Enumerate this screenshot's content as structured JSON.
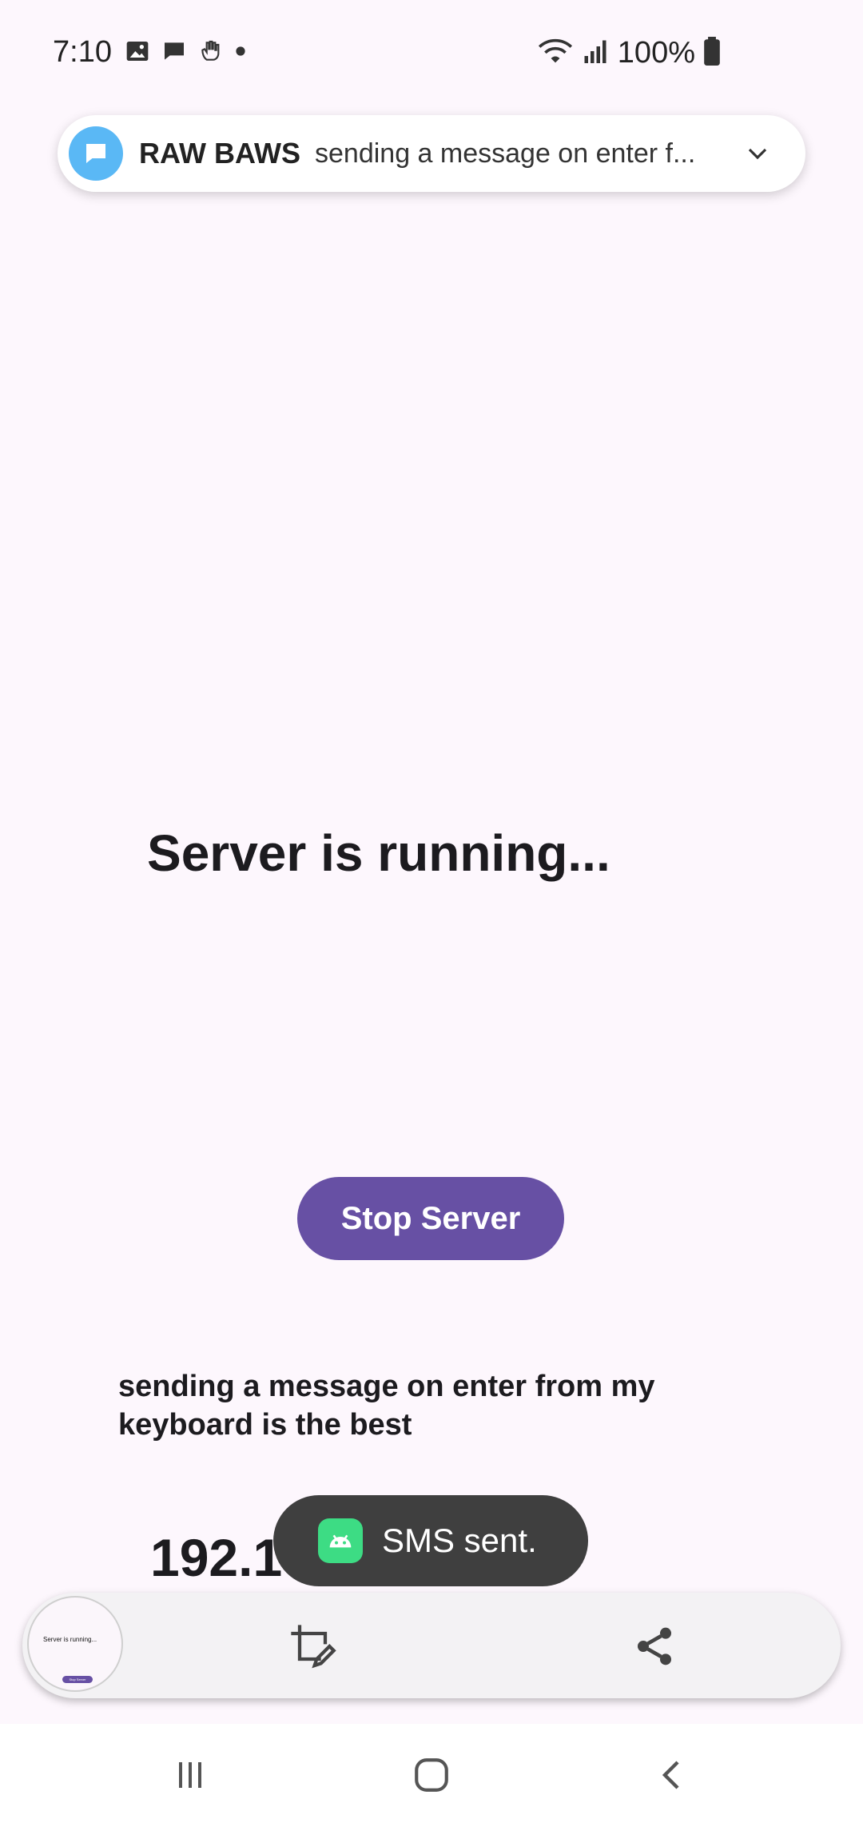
{
  "status_bar": {
    "time": "7:10",
    "battery": "100%",
    "icons": [
      "image-icon",
      "message-icon",
      "hand-icon",
      "dot-icon",
      "wifi-icon",
      "signal-icon",
      "battery-icon"
    ]
  },
  "notification": {
    "app_name": "RAW BAWS",
    "text": "sending a message on enter f...",
    "icon": "chat-bubble-icon",
    "icon_color": "#5ab8f5"
  },
  "main": {
    "title": "Server is running...",
    "stop_button_label": "Stop Server",
    "message": "sending a message on enter from my keyboard is the best",
    "ip_address": "192.168.0.5"
  },
  "toast": {
    "text": "SMS sent.",
    "icon": "android-icon"
  },
  "screenshot_toolbar": {
    "thumbnail_title": "Server is running...",
    "thumbnail_button": "Stop Server"
  },
  "colors": {
    "accent": "#6750a4",
    "background": "#fdf7fd",
    "toast_bg": "#3f3f3f"
  }
}
